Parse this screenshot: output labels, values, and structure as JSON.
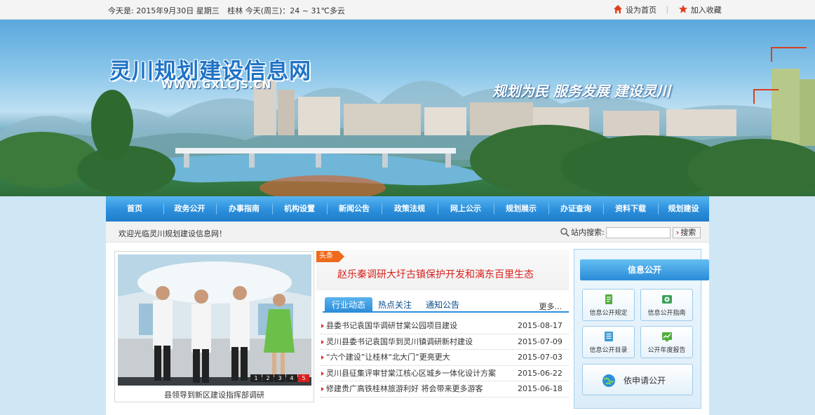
{
  "topbar": {
    "date": "今天是: 2015年9月30日 星期三",
    "weather": "桂林 今天(周三)：24 ~ 31℃多云",
    "set_home": "设为首页",
    "favorite": "加入收藏"
  },
  "header": {
    "site_title": "灵川规划建设信息网",
    "site_url": "WWW.GXLCJS.CN",
    "slogan": "规划为民  服务发展  建设灵川"
  },
  "nav": {
    "items": [
      "首页",
      "政务公开",
      "办事指南",
      "机构设置",
      "新闻公告",
      "政策法规",
      "网上公示",
      "规划展示",
      "办证查询",
      "资料下载",
      "规划建设"
    ]
  },
  "welcome": {
    "message": "欢迎光临灵川规划建设信息网！",
    "search_label": "站内搜索:",
    "search_value": "",
    "search_button": "搜索"
  },
  "slideshow": {
    "caption": "县领导到新区建设指挥部调研",
    "pages": [
      "1",
      "2",
      "3",
      "4",
      "5"
    ],
    "active_page": "5"
  },
  "headline": {
    "tag": "头条",
    "title": "赵乐秦调研大圩古镇保护开发和漓东百里生态"
  },
  "news_tabs": {
    "tabs": [
      "行业动态",
      "热点关注",
      "通知公告"
    ],
    "active": "行业动态",
    "more": "更多..."
  },
  "news": [
    {
      "title": "县委书记袁国华调研甘棠公园项目建设",
      "date": "2015-08-17"
    },
    {
      "title": "灵川县委书记袁国华到灵川镇调研新村建设",
      "date": "2015-07-09"
    },
    {
      "title": "“六个建设”让桂林“北大门”更亮更大",
      "date": "2015-07-03"
    },
    {
      "title": "灵川县征集评审甘棠江核心区城乡一体化设计方案",
      "date": "2015-06-22"
    },
    {
      "title": "修建贵广高铁桂林旅游利好 将会带来更多游客",
      "date": "2015-06-18"
    }
  ],
  "info_panel": {
    "title": "信息公开",
    "buttons": [
      "信息公开规定",
      "信息公开指南",
      "信息公开目录",
      "公开年度报告"
    ],
    "apply": "依申请公开"
  },
  "colors": {
    "accent": "#2c8fdc",
    "headline_red": "#d8211e",
    "tag_orange": "#ef6a1a",
    "title_blue": "#1f73c6"
  }
}
